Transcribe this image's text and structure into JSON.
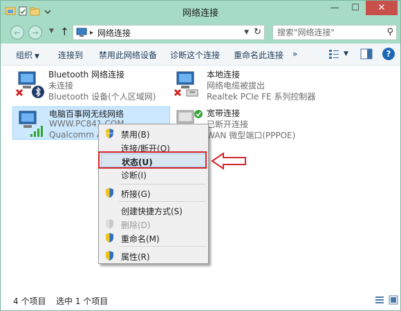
{
  "window": {
    "title": "网络连接",
    "controls": {
      "minimize": "—",
      "maximize": "☐",
      "close": "✕"
    }
  },
  "navigation": {
    "back": "←",
    "forward": "→",
    "up": "↑",
    "address_path": "网络连接",
    "address_separator": "▸",
    "refresh": "↻",
    "search_placeholder": "搜索\"网络连接\""
  },
  "commands": [
    {
      "label": "组织",
      "has_dropdown": true
    },
    {
      "label": "连接到"
    },
    {
      "label": "禁用此网络设备"
    },
    {
      "label": "诊断这个连接"
    },
    {
      "label": "重命名此连接"
    },
    {
      "label": "»"
    }
  ],
  "connections": [
    {
      "name": "Bluetooth 网络连接",
      "status": "未连接",
      "device": "Bluetooth 设备(个人区域网)",
      "icon": "bluetooth-adapter-icon",
      "selected": false
    },
    {
      "name": "本地连接",
      "status": "网络电缆被拔出",
      "device": "Realtek PCIe FE 系列控制器",
      "icon": "ethernet-adapter-icon",
      "selected": false
    },
    {
      "name": "电脑百事网无线网络",
      "status": "WWW.PC841.COM",
      "device": "Qualcomm Ath",
      "icon": "wifi-adapter-icon",
      "selected": true
    },
    {
      "name": "宽带连接",
      "status": "已断开连接",
      "device": "WAN 微型端口(PPPOE)",
      "icon": "broadband-connection-icon",
      "selected": false
    }
  ],
  "context_menu": {
    "items": [
      {
        "label": "禁用(B)",
        "shield": true,
        "disabled": false
      },
      {
        "label": "连接/断开(O)",
        "shield": false,
        "disabled": false
      },
      {
        "label": "状态(U)",
        "shield": false,
        "disabled": false,
        "highlighted": true,
        "bold": true
      },
      {
        "label": "诊断(I)",
        "shield": false,
        "disabled": false
      },
      {
        "label": "桥接(G)",
        "shield": true,
        "disabled": false
      },
      {
        "label": "创建快捷方式(S)",
        "shield": false,
        "disabled": false
      },
      {
        "label": "删除(D)",
        "shield": true,
        "disabled": true
      },
      {
        "label": "重命名(M)",
        "shield": true,
        "disabled": false
      },
      {
        "label": "属性(R)",
        "shield": true,
        "disabled": false
      }
    ]
  },
  "annotation": {
    "color": "#d6232b"
  },
  "status_bar": {
    "item_count": "4 个项目",
    "selection": "选中 1 个项目"
  },
  "colors": {
    "titlebar": "#a6dcc6",
    "selection": "#cce8ff",
    "close_button": "#c7504a",
    "annotation_red": "#d6232b"
  }
}
